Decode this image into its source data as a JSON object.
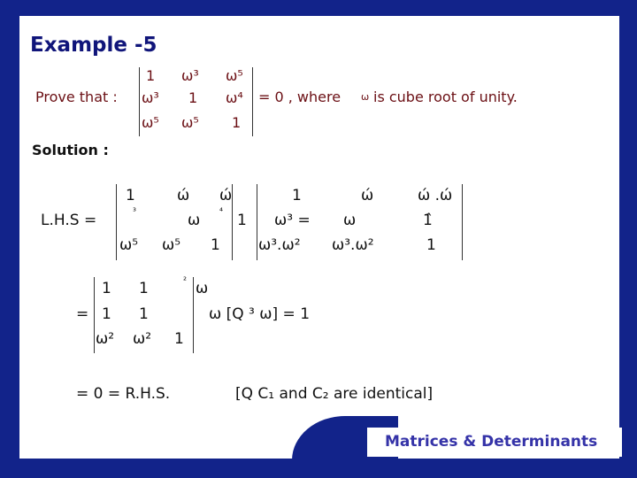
{
  "title": "Example -5",
  "problem": {
    "prefix": "Prove that :",
    "suffix": "= 0 , where",
    "omega": "ω",
    "tail": "is cube root of unity.",
    "matrix": [
      [
        "1",
        "ω³",
        "ω⁵"
      ],
      [
        "ω³",
        "1",
        "ω⁴"
      ],
      [
        "ω⁵",
        "ω⁵",
        "1"
      ]
    ]
  },
  "solution_label": "Solution :",
  "step1": {
    "lhs": "L.H.S =",
    "m1": [
      [
        "1",
        "ώ",
        "ώ"
      ],
      [
        "³",
        "ω",
        "⁴"
      ],
      [
        "ω⁵",
        "ω⁵",
        "1"
      ]
    ],
    "mid": "1",
    "m2": [
      [
        "1",
        "ώ",
        "ώ .ώ"
      ],
      [
        "ω³ =",
        "ω",
        "1̂"
      ],
      [
        "ω³.ω²",
        "ω³.ω²",
        "1"
      ]
    ]
  },
  "step2": {
    "eq": "=",
    "m": [
      [
        "1",
        "1",
        "²"
      ],
      [
        "1",
        "1",
        ""
      ],
      [
        "ω²",
        "ω²",
        "1"
      ]
    ],
    "after_top": "ω",
    "note": "ω [Q   ³   ω] = 1"
  },
  "step3": {
    "result": "= 0 = R.H.S.",
    "reason": "[Q C₁ and C₂ are identical]"
  },
  "footer": "Matrices & Determinants",
  "colors": {
    "background": "#12238a",
    "title": "#10157a",
    "problem_text": "#6b0f14",
    "footer_text": "#3533a8"
  }
}
